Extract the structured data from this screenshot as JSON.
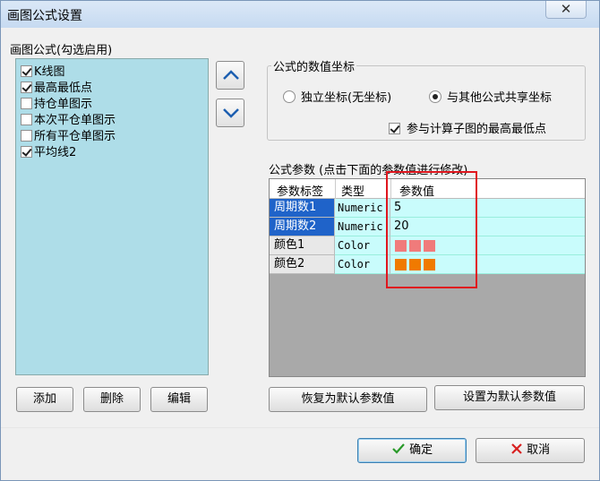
{
  "window": {
    "title": "画图公式设置",
    "close_glyph": "✕"
  },
  "formula_list": {
    "label": "画图公式(勾选启用)",
    "items": [
      {
        "label": "K线图",
        "checked": true
      },
      {
        "label": "最高最低点",
        "checked": true
      },
      {
        "label": "持仓单图示",
        "checked": false
      },
      {
        "label": "本次平仓单图示",
        "checked": false
      },
      {
        "label": "所有平仓单图示",
        "checked": false
      },
      {
        "label": "平均线2",
        "checked": true
      }
    ]
  },
  "move_buttons": {
    "up_icon": "chevron-up-icon",
    "down_icon": "chevron-down-icon"
  },
  "value_axis": {
    "legend": "公式的数值坐标",
    "options": [
      {
        "label": "独立坐标(无坐标)",
        "selected": false
      },
      {
        "label": "与其他公式共享坐标",
        "selected": true
      }
    ],
    "include_extremes_label": "参与计算子图的最高最低点",
    "include_extremes_checked": true
  },
  "params": {
    "label": "公式参数 (点击下面的参数值进行修改)",
    "headers": [
      "参数标签",
      "类型",
      "参数值"
    ],
    "rows": [
      {
        "label": "周期数1",
        "type": "Numeric",
        "value": "5",
        "selected": true
      },
      {
        "label": "周期数2",
        "type": "Numeric",
        "value": "20",
        "selected": true
      },
      {
        "label": "颜色1",
        "type": "Color",
        "value": "",
        "swatch": "#f07b7b"
      },
      {
        "label": "颜色2",
        "type": "Color",
        "value": "",
        "swatch": "#f07a00"
      }
    ],
    "highlight_color": "#e0161e"
  },
  "list_buttons": {
    "add": "添加",
    "delete": "删除",
    "edit": "编辑"
  },
  "param_buttons": {
    "restore_default": "恢复为默认参数值",
    "set_default": "设置为默认参数值"
  },
  "footer": {
    "ok": "确定",
    "cancel": "取消",
    "ok_icon": "check-icon",
    "cancel_icon": "x-icon"
  }
}
